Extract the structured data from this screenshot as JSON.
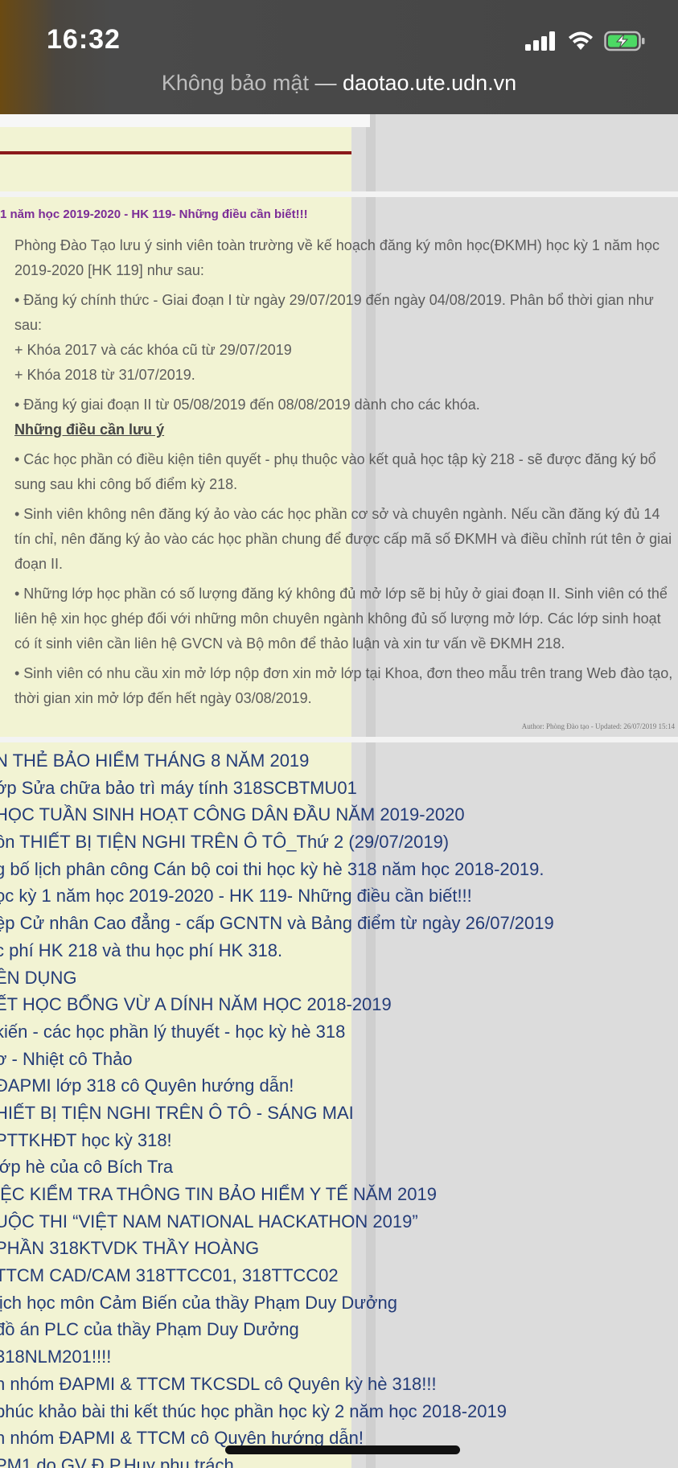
{
  "status_bar": {
    "time": "16:32",
    "security": "Không bảo mật",
    "separator": "—",
    "domain": "daotao.ute.udn.vn"
  },
  "article": {
    "title": "1 năm học 2019-2020 - HK 119- Những điều cần biết!!!",
    "paragraphs": [
      "Phòng Đào Tạo lưu ý sinh viên toàn trường về kế hoạch đăng ký môn học(ĐKMH) học kỳ 1 năm học 2019-2020 [HK 119] như sau:",
      "•  Đăng ký chính thức - Giai đoạn I từ ngày 29/07/2019 đến ngày 04/08/2019. Phân bổ thời gian như sau:",
      "+ Khóa 2017 và các khóa cũ từ 29/07/2019",
      "+ Khóa 2018 từ 31/07/2019.",
      "•  Đăng ký giai đoạn II từ 05/08/2019 đến 08/08/2019 dành cho các khóa."
    ],
    "notes_heading": "Những điều cần lưu ý",
    "notes": [
      "•  Các học phần có điều kiện tiên quyết - phụ thuộc vào kết quả học tập kỳ 218 - sẽ được đăng ký bổ sung sau khi công bố điểm kỳ 218.",
      "•  Sinh viên không nên đăng ký ảo vào các học phần cơ sở và chuyên ngành. Nếu cần đăng ký đủ 14 tín chỉ, nên đăng ký ảo vào các học phần chung để được cấp mã số ĐKMH và điều chỉnh rút tên ở giai đoạn II.",
      "•  Những lớp học phần có số lượng đăng ký không đủ mở lớp sẽ bị hủy ở giai đoạn II. Sinh viên có thể liên hệ xin học ghép đối với những môn chuyên ngành không đủ số lượng mở lớp. Các lớp sinh hoạt có ít sinh viên cần liên hệ GVCN và Bộ môn để thảo luận và xin tư vấn về ĐKMH 218.",
      "•  Sinh viên có nhu cầu xin mở lớp nộp đơn xin mở lớp tại Khoa, đơn theo mẫu trên trang Web đào tạo, thời gian xin mở lớp đến hết ngày 03/08/2019."
    ],
    "author_line": "Author: Phòng Đào tạo - Updated: 26/07/2019 15:14"
  },
  "links": [
    "N THẺ BẢO HIỂM THÁNG 8 NĂM 2019",
    "ớp Sửa chữa bảo trì máy tính 318SCBTMU01",
    " HỌC TUẦN SINH HOẠT CÔNG DÂN ĐẦU NĂM 2019-2020",
    "ôn THIẾT BỊ TIỆN NGHI TRÊN Ô TÔ_Thứ 2 (29/07/2019)",
    "g bố lịch phân công Cán bộ coi thi học kỳ hè 318 năm học 2018-2019.",
    "ọc kỳ 1 năm học 2019-2020 - HK 119- Những điều cần biết!!!",
    "ệp Cử nhân Cao đẳng - cấp GCNTN và Bảng điểm từ ngày 26/07/2019",
    "c phí HK 218 và thu học phí HK 318.",
    "ÊN DỤNG",
    "ẾT HỌC BỔNG VỪ A DÍNH NĂM HỌC 2018-2019",
    "kiến - các học phần lý thuyết - học kỳ hè 318",
    "ơ - Nhiệt cô Thảo",
    " ĐAPMI lớp 318 cô Quyên hướng dẫn!",
    "HIẾT BỊ TIỆN NGHI TRÊN Ô TÔ - SÁNG MAI",
    " PTTKHĐT học kỳ 318!",
    " lớp hè của cô Bích Tra",
    "IỆC KIỂM TRA THÔNG TIN BẢO HIỂM Y TẾ NĂM 2019",
    "UỘC THI “VIỆT NAM NATIONAL HACKATHON 2019”",
    " PHẦN 318KTVDK THẦY HOÀNG",
    " TTCM CAD/CAM 318TTCC01, 318TTCC02",
    " lịch học môn Cảm Biến của thầy Phạm Duy Dưởng",
    " đồ án PLC của thầy Phạm Duy Dưởng",
    " 318NLM201!!!!",
    "n nhóm ĐAPMI & TTCM TKCSDL cô Quyên kỳ hè 318!!!",
    "phúc khảo bài thi kết thúc học phần học kỳ 2 năm học 2018-2019",
    "n nhóm ĐAPMI & TTCM cô Quyên hướng dẫn!",
    "PM1 do GV Đ.P.Huy phụ trách"
  ],
  "colors": {
    "status_bg": "#454545",
    "page_column": "#f2f3d3",
    "article_title": "#7b2c97",
    "link": "#243c78",
    "rule": "#8b1a1a"
  },
  "icons": [
    "signal-icon",
    "wifi-icon",
    "battery-charging-icon"
  ]
}
